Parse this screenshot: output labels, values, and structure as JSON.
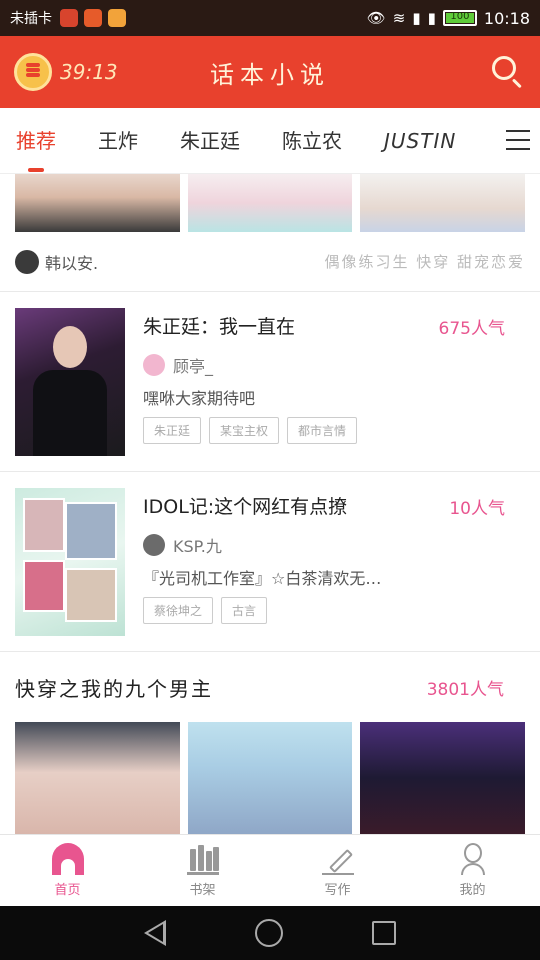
{
  "status_bar": {
    "carrier": "未插卡",
    "time": "10:18",
    "battery": "100"
  },
  "header": {
    "timer": "39:13",
    "brand": "话本小说"
  },
  "tabs": [
    {
      "label": "推荐",
      "active": true
    },
    {
      "label": "王炸",
      "active": false
    },
    {
      "label": "朱正廷",
      "active": false
    },
    {
      "label": "陈立农",
      "active": false
    },
    {
      "label": "JUSTIN",
      "active": false
    }
  ],
  "top_item": {
    "author": "韩以安.",
    "tags": "偶像练习生 快穿 甜宠恋爱"
  },
  "books": [
    {
      "title": "朱正廷：我一直在",
      "popularity": "675人气",
      "author": "顾亭_",
      "desc": "嘿咻大家期待吧",
      "tags": [
        "朱正廷",
        "某宝主权",
        "都市言情"
      ]
    },
    {
      "title": "IDOL记:这个网红有点撩",
      "popularity": "10人气",
      "author": "KSP.九",
      "desc": "『光司机工作室』☆白茶清欢无…",
      "tags": [
        "蔡徐坤之",
        "古言"
      ]
    }
  ],
  "section": {
    "title": "快穿之我的九个男主",
    "popularity": "3801人气"
  },
  "bottom_nav": [
    {
      "label": "首页",
      "active": true
    },
    {
      "label": "书架",
      "active": false
    },
    {
      "label": "写作",
      "active": false
    },
    {
      "label": "我的",
      "active": false
    }
  ],
  "colors": {
    "header": "#e8412d",
    "accent_pink": "#e8558f"
  }
}
